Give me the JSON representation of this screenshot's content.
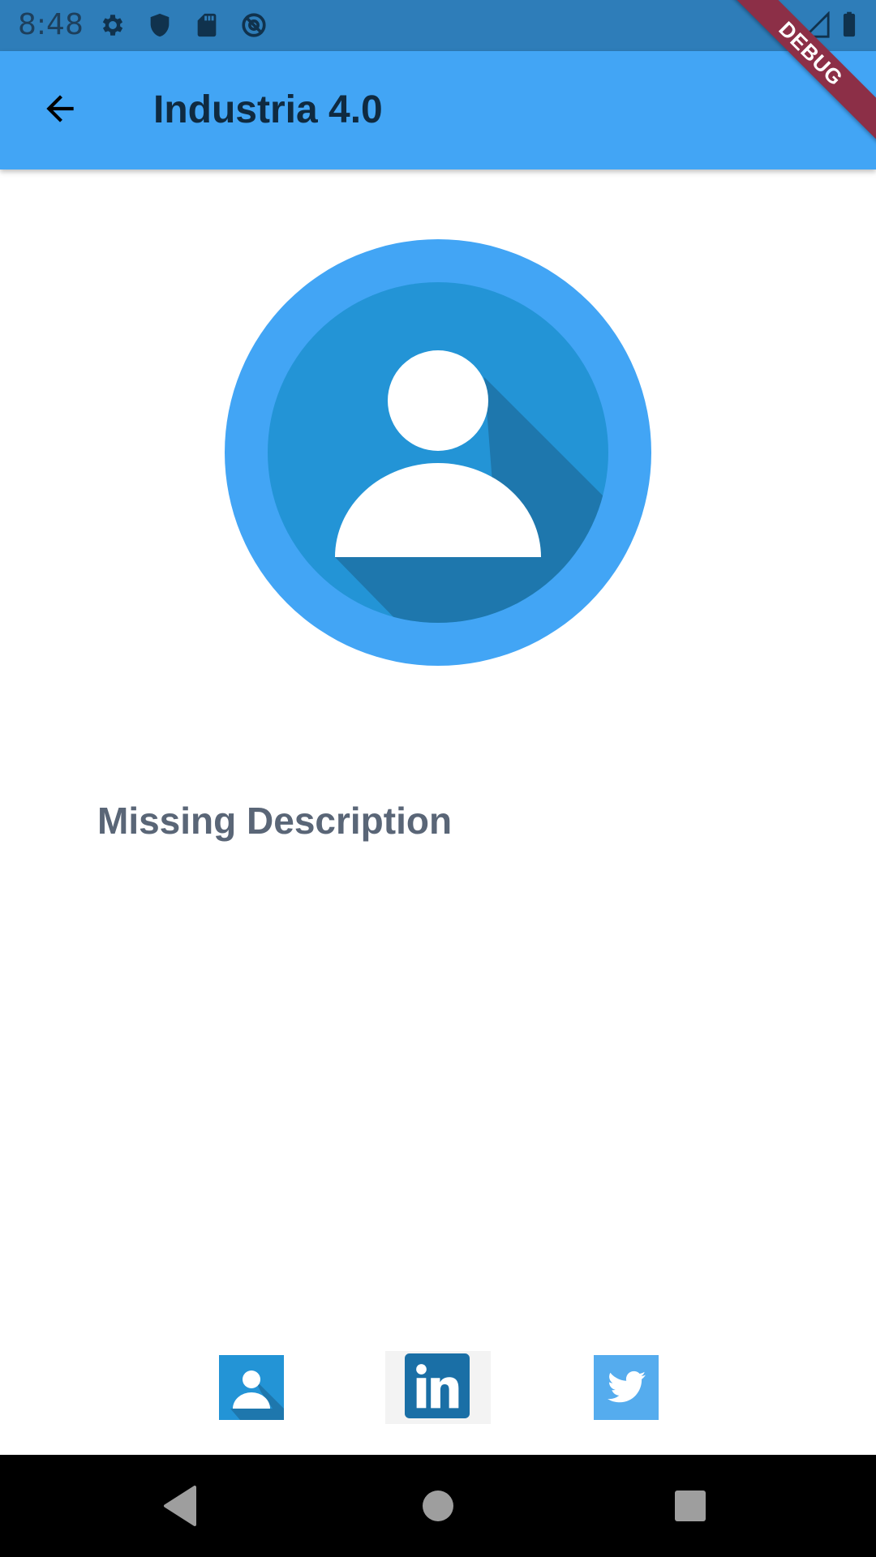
{
  "status_bar": {
    "time": "8:48",
    "icons": [
      "gear-icon",
      "shield-icon",
      "sd-card-icon",
      "at-sign-icon",
      "wifi-icon",
      "signal-icon",
      "battery-icon"
    ]
  },
  "app_bar": {
    "title": "Industria 4.0",
    "back_icon": "arrow-left-icon",
    "color": "#42a5f5"
  },
  "debug_banner": "DEBUG",
  "profile": {
    "avatar": "user-avatar-icon",
    "description": "Missing Description"
  },
  "social_links": [
    {
      "name": "profile",
      "icon": "person-icon"
    },
    {
      "name": "linkedin",
      "icon": "linkedin-icon"
    },
    {
      "name": "twitter",
      "icon": "twitter-icon"
    }
  ],
  "nav_bar": {
    "buttons": [
      "back-triangle-icon",
      "home-circle-icon",
      "recents-square-icon"
    ]
  },
  "colors": {
    "status_bar": "#2e7db9",
    "app_bar": "#42a5f5",
    "avatar_inner": "#2394d6",
    "avatar_shadow": "#1e77ad",
    "description_text": "#5a6677"
  }
}
